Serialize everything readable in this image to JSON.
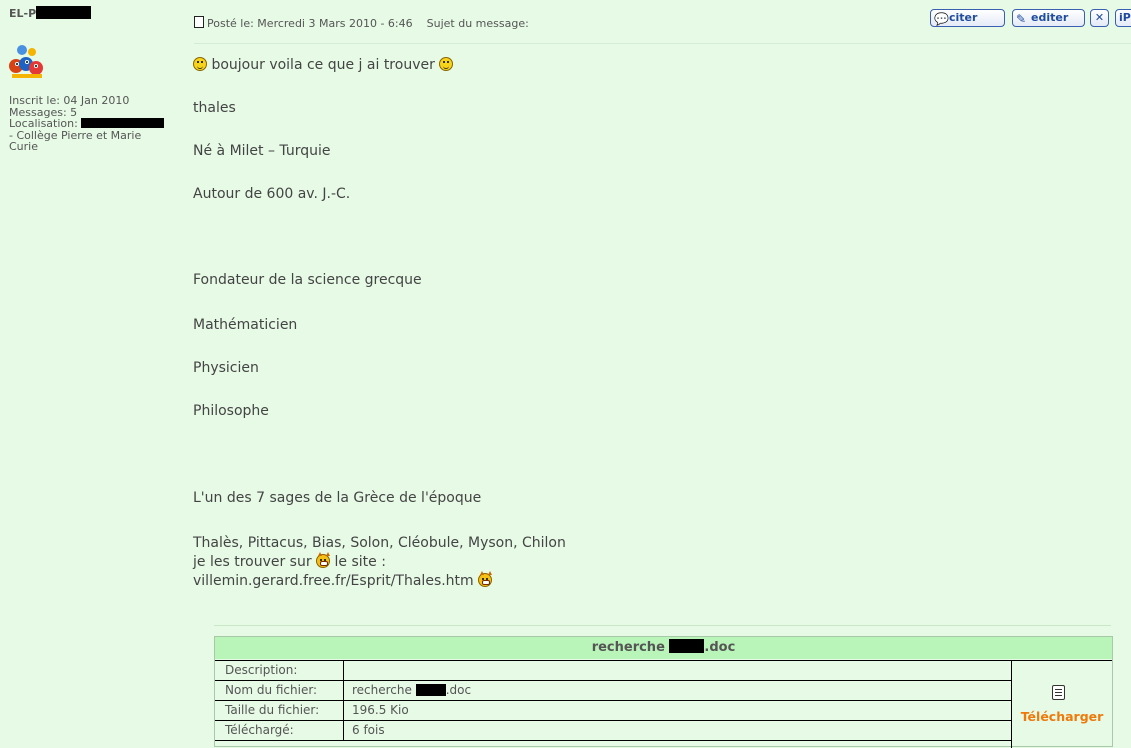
{
  "profile": {
    "username_prefix": "EL-P",
    "registered": "Inscrit le: 04 Jan 2010",
    "messages": "Messages: 5",
    "location_label": "Localisation:",
    "location_line2": "- Collège Pierre et Marie",
    "location_line3": "Curie"
  },
  "post": {
    "posted": "Posté le: Mercredi 3 Mars 2010 - 6:46",
    "subject_label": "Sujet du message:",
    "buttons": {
      "quote": "citer",
      "edit": "editer",
      "delete": "✕",
      "ip": "iP"
    },
    "lines": [
      "boujour voila ce que j ai trouver",
      "thales",
      "Né à Milet – Turquie",
      "Autour de 600 av. J.-C.",
      "Fondateur de la science grecque",
      "Mathématicien",
      "Physicien",
      "Philosophe",
      "L'un des 7 sages de la Grèce de l'époque",
      "Thalès, Pittacus, Bias, Solon, Cléobule, Myson, Chilon",
      "je les trouver sur",
      "le site :",
      "villemin.gerard.free.fr/Esprit/Thales.htm"
    ]
  },
  "attachment": {
    "title_prefix": "recherche",
    "title_suffix": ".doc",
    "rows": [
      {
        "label": "Description:",
        "value": ""
      },
      {
        "label": "Nom du fichier:",
        "value": "recherche",
        "value_suffix": ".doc"
      },
      {
        "label": "Taille du fichier:",
        "value": "196.5 Kio"
      },
      {
        "label": "Téléchargé:",
        "value": "6 fois"
      }
    ],
    "download_label": "Télécharger"
  },
  "colors": {
    "background": "#e6fae6",
    "table_header": "#b9f4b9",
    "download": "#ee7a0a",
    "button_text": "#1f4c9e"
  },
  "icons": [
    "avatar-image",
    "document-icon",
    "quote-icon",
    "edit-icon",
    "delete-icon",
    "smiley-icon",
    "devil-smiley-icon",
    "download-file-icon"
  ]
}
